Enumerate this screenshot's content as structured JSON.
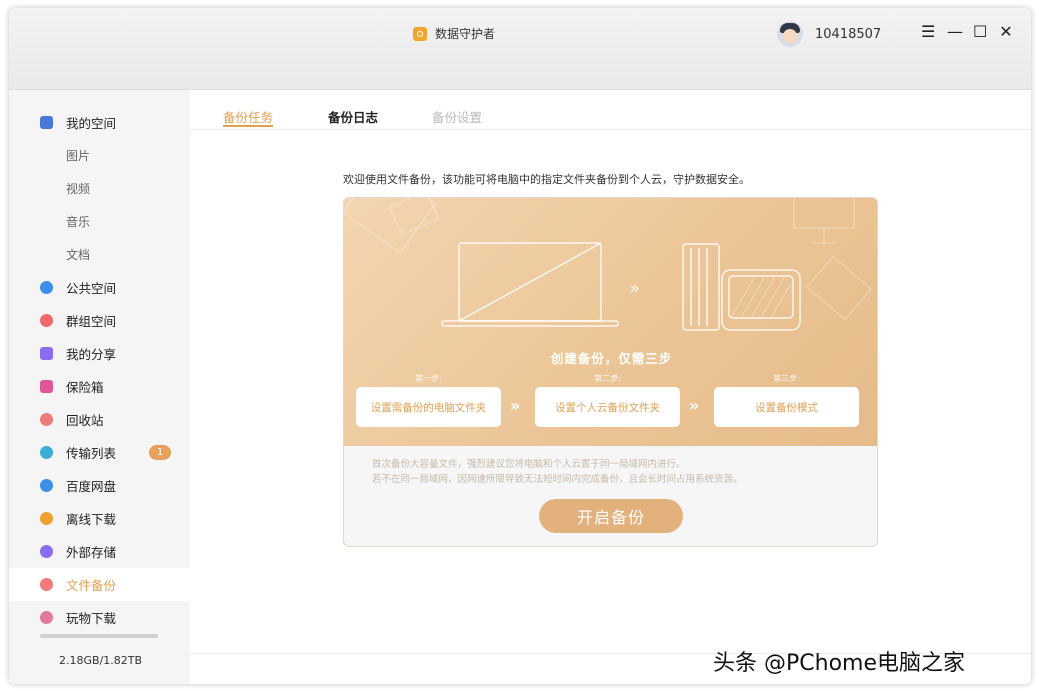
{
  "app": {
    "title": "数据守护者"
  },
  "user": {
    "id": "10418507"
  },
  "window_controls": {
    "menu": "☰",
    "minimize": "—",
    "maximize": "☐",
    "close": "✕"
  },
  "sidebar": {
    "items": [
      {
        "label": "我的空间",
        "icon": "my-space-icon",
        "color": "#4a78d9"
      },
      {
        "label": "图片"
      },
      {
        "label": "视频"
      },
      {
        "label": "音乐"
      },
      {
        "label": "文档"
      },
      {
        "label": "公共空间",
        "icon": "public-space-icon",
        "color": "#3b8fe8"
      },
      {
        "label": "群组空间",
        "icon": "group-space-icon",
        "color": "#f06a6a"
      },
      {
        "label": "我的分享",
        "icon": "share-icon",
        "color": "#8a6cf0"
      },
      {
        "label": "保险箱",
        "icon": "safe-icon",
        "color": "#e0569a"
      },
      {
        "label": "回收站",
        "icon": "trash-icon",
        "color": "#f07a7a"
      },
      {
        "label": "传输列表",
        "icon": "transfer-icon",
        "color": "#3aaed8",
        "badge": "1"
      },
      {
        "label": "百度网盘",
        "icon": "baidu-cloud-icon",
        "color": "#3b8fe8"
      },
      {
        "label": "离线下载",
        "icon": "offline-download-icon",
        "color": "#f0a030"
      },
      {
        "label": "外部存储",
        "icon": "external-storage-icon",
        "color": "#8a6cf0"
      },
      {
        "label": "文件备份",
        "icon": "file-backup-icon",
        "color": "#f07a7a"
      },
      {
        "label": "玩物下载",
        "icon": "wanwu-download-icon",
        "color": "#e07a9a"
      }
    ],
    "storage": "2.18GB/1.82TB",
    "storage_used_fraction": 0.0012
  },
  "tabs": [
    {
      "label": "备份任务"
    },
    {
      "label": "备份日志"
    },
    {
      "label": "备份设置"
    }
  ],
  "main": {
    "intro": "欢迎使用文件备份，该功能可将电脑中的指定文件夹备份到个人云，守护数据安全。",
    "heading": "创建备份，仅需三步",
    "steps": [
      {
        "caption": "第一步:",
        "label": "设置需备份的电脑文件夹"
      },
      {
        "caption": "第二步:",
        "label": "设置个人云备份文件夹"
      },
      {
        "caption": "第三步:",
        "label": "设置备份模式"
      }
    ],
    "arrow": "»",
    "notes": [
      "首次备份大容量文件，强烈建议您将电脑和个人云置于同一局域网内进行。",
      "若不在同一局域网，因网速所限导致无法短时间内完成备份，且会长时间占用系统资源。"
    ],
    "start_button": "开启备份"
  },
  "watermark": "头条 @PChome电脑之家",
  "colors": {
    "accent": "#e0a050",
    "banner": "#ebc597",
    "badge": "#e6a25a"
  }
}
